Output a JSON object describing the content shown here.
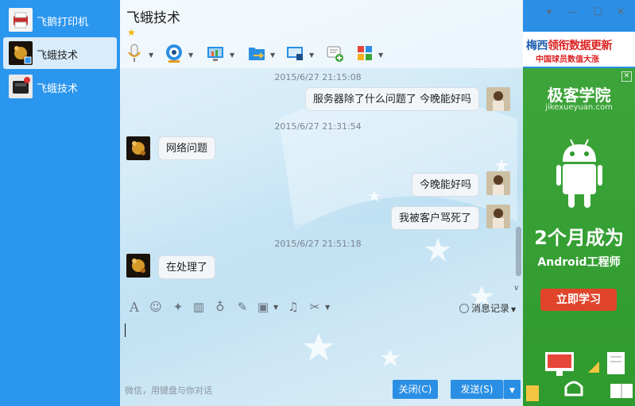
{
  "contacts": [
    {
      "name": "飞鹅打印机",
      "active": false
    },
    {
      "name": "飞蛾技术",
      "active": true
    },
    {
      "name": "飞蛾技术",
      "active": false
    }
  ],
  "chat": {
    "title": "飞蛾技术",
    "window_buttons": {
      "menu": "▾",
      "minimize": "—",
      "maximize": "☐",
      "close": "✕"
    }
  },
  "messages": [
    {
      "type": "timestamp",
      "text": "2015/6/27 21:15:08"
    },
    {
      "type": "message",
      "side": "out",
      "text": "服务器除了什么问题了 今晚能好吗"
    },
    {
      "type": "timestamp",
      "text": "2015/6/27 21:31:54"
    },
    {
      "type": "message",
      "side": "in",
      "text": "网络问题"
    },
    {
      "type": "message",
      "side": "out",
      "text": "今晚能好吗"
    },
    {
      "type": "message",
      "side": "out",
      "text": "我被客户骂死了"
    },
    {
      "type": "timestamp",
      "text": "2015/6/27 21:51:18"
    },
    {
      "type": "message",
      "side": "in",
      "text": "在处理了"
    }
  ],
  "input": {
    "history_label": "消息记录",
    "hint": "微信，用键盘与你对话",
    "close_label": "关闭(C)",
    "send_label": "发送(S)"
  },
  "ad": {
    "top_line1_blue": "梅西",
    "top_line1_red": "领衔数据更新",
    "top_line2": "中国球员数值大涨",
    "brand": "极客学院",
    "url": "jikexueyuan.com",
    "headline": "2个月成为",
    "subline": "Android工程师",
    "cta": "立即学习"
  },
  "colors": {
    "accent": "#2a8fe4",
    "sidebar": "#2b96ee",
    "ad_green": "#3da53a",
    "cta": "#e0452b"
  }
}
